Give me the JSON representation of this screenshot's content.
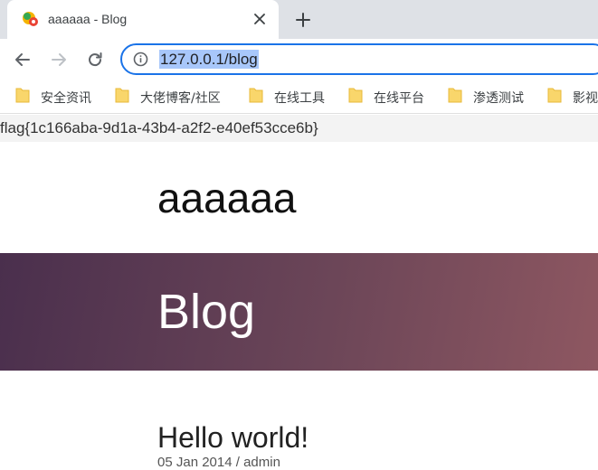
{
  "browser": {
    "tab": {
      "title": "aaaaaa - Blog"
    },
    "address_bar": {
      "url": "127.0.0.1/blog"
    },
    "bookmarks": [
      {
        "label": "安全资讯"
      },
      {
        "label": "大佬博客/社区"
      },
      {
        "label": "在线工具"
      },
      {
        "label": "在线平台"
      },
      {
        "label": "渗透测试"
      },
      {
        "label": "影视"
      }
    ],
    "colors": {
      "tabstrip": "#dee1e6",
      "omnibox_border": "#1a73e8",
      "url_selection": "#a8c7fa",
      "folder": "#f9d66b"
    },
    "icons": [
      "site-favicon",
      "close-icon",
      "plus-icon",
      "back-arrow-icon",
      "forward-arrow-icon",
      "reload-icon",
      "info-icon",
      "folder-icon"
    ]
  },
  "page": {
    "flag": "flag{1c166aba-9d1a-43b4-a2f2-e40ef53cce6b}",
    "site_title": "aaaaaa",
    "hero_title": "Blog",
    "post": {
      "title": "Hello world!",
      "date": "05 Jan 2014",
      "separator": "/",
      "author": "admin"
    },
    "colors": {
      "hero_gradient_start": "#4a2f4d",
      "hero_gradient_end": "#8e5761"
    }
  }
}
